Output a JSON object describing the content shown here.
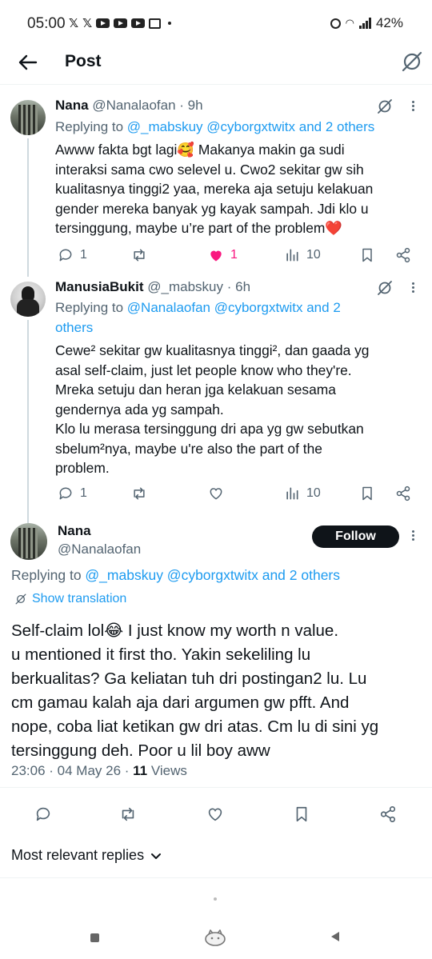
{
  "status_bar": {
    "time": "05:00",
    "battery": "42%"
  },
  "header": {
    "title": "Post"
  },
  "replies": [
    {
      "name": "Nana",
      "handle": "@Nanalaofan",
      "time": "· 9h",
      "replying_prefix": "Replying to ",
      "replying_targets": "@_mabskuy @cyborgxtwitx and 2 others",
      "body_lines": [
        "Awww fakta bgt lagi🥰 Makanya makin ga sudi",
        "interaksi sama cwo selevel u. Cwo2 sekitar gw sih",
        "kualitasnya tinggi2 yaa, mereka aja setuju kelakuan",
        "gender mereka banyak yg kayak sampah. Jdi klo u",
        "tersinggung, maybe u’re part of the problem❤️"
      ],
      "reply_count": "1",
      "like_count": "1",
      "view_count": "10"
    },
    {
      "name": "ManusiaBukit",
      "handle": "@_mabskuy",
      "time": "· 6h",
      "replying_prefix": "Replying to ",
      "replying_targets_line1": "@Nanalaofan @cyborgxtwitx and 2",
      "replying_targets_line2": "others",
      "body_lines": [
        "Cewe² sekitar gw kualitasnya tinggi², dan gaada yg",
        "asal self-claim, just let people know who they're.",
        "Mreka setuju dan heran jga kelakuan sesama",
        "gendernya ada yg sampah.",
        "Klo lu merasa tersinggung dri apa yg gw sebutkan",
        "sbelum²nya, maybe u're also the part of the",
        "problem."
      ],
      "reply_count": "1",
      "view_count": "10"
    }
  ],
  "main_post": {
    "name": "Nana",
    "handle": "@Nanalaofan",
    "follow_label": "Follow",
    "replying_prefix": "Replying to ",
    "replying_targets": "@_mabskuy @cyborgxtwitx and 2 others",
    "show_translation": "Show translation",
    "body_lines": [
      "Self-claim lol😂 I just know my worth n value.",
      "u mentioned it first tho. Yakin sekeliling lu",
      "berkualitas? Ga keliatan tuh dri postingan2 lu. Lu",
      "cm gamau kalah aja dari argumen gw pfft. And",
      "nope, coba liat ketikan gw dri atas. Cm lu di sini yg",
      "tersinggung deh. Poor u lil boy aww"
    ],
    "timestamp": "23:06 · 04 May 26 · ",
    "views_count": "11",
    "views_label": " Views"
  },
  "sort_label": "Most relevant replies",
  "colors": {
    "link": "#1d9bf0",
    "like_active": "#f91880",
    "muted": "#536471",
    "text": "#0f1419"
  },
  "icons": [
    "back-arrow-icon",
    "grok-icon",
    "more-icon",
    "reply-icon",
    "retweet-icon",
    "like-icon",
    "views-icon",
    "bookmark-icon",
    "share-icon",
    "translate-icon",
    "chevron-down-icon"
  ]
}
